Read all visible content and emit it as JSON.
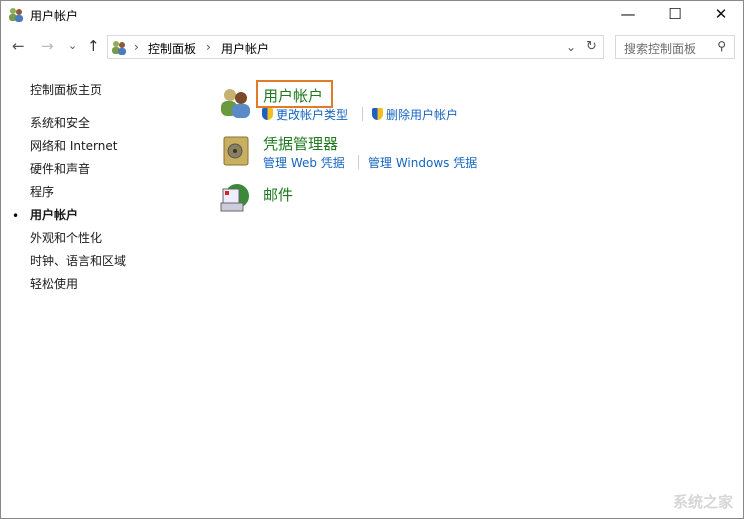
{
  "window": {
    "title": "用户帐户",
    "minimize": "—",
    "maximize": "☐",
    "close": "✕"
  },
  "nav": {
    "back": "←",
    "forward": "→",
    "recent": "⌄",
    "up": "↑",
    "breadcrumb": [
      "控制面板",
      "用户帐户"
    ],
    "dropdown": "⌄",
    "refresh": "↻",
    "search_placeholder": "搜索控制面板",
    "search_icon": "⚲"
  },
  "sidebar": {
    "items": [
      {
        "label": "控制面板主页"
      },
      {
        "label": "系统和安全"
      },
      {
        "label": "网络和 Internet"
      },
      {
        "label": "硬件和声音"
      },
      {
        "label": "程序"
      },
      {
        "label": "用户帐户",
        "active": true
      },
      {
        "label": "外观和个性化"
      },
      {
        "label": "时钟、语言和区域"
      },
      {
        "label": "轻松使用"
      }
    ],
    "bullet": "•"
  },
  "categories": [
    {
      "title": "用户帐户",
      "icon": "users-icon",
      "links": [
        "更改帐户类型",
        "删除用户帐户"
      ]
    },
    {
      "title": "凭据管理器",
      "icon": "vault-icon",
      "links": [
        "管理 Web 凭据",
        "管理 Windows 凭据"
      ]
    },
    {
      "title": "邮件",
      "icon": "mail-icon",
      "links": []
    }
  ],
  "colors": {
    "highlight": "#e07b28",
    "category": "#1e7a1e",
    "link": "#1565c0"
  },
  "watermark": "系统之家"
}
